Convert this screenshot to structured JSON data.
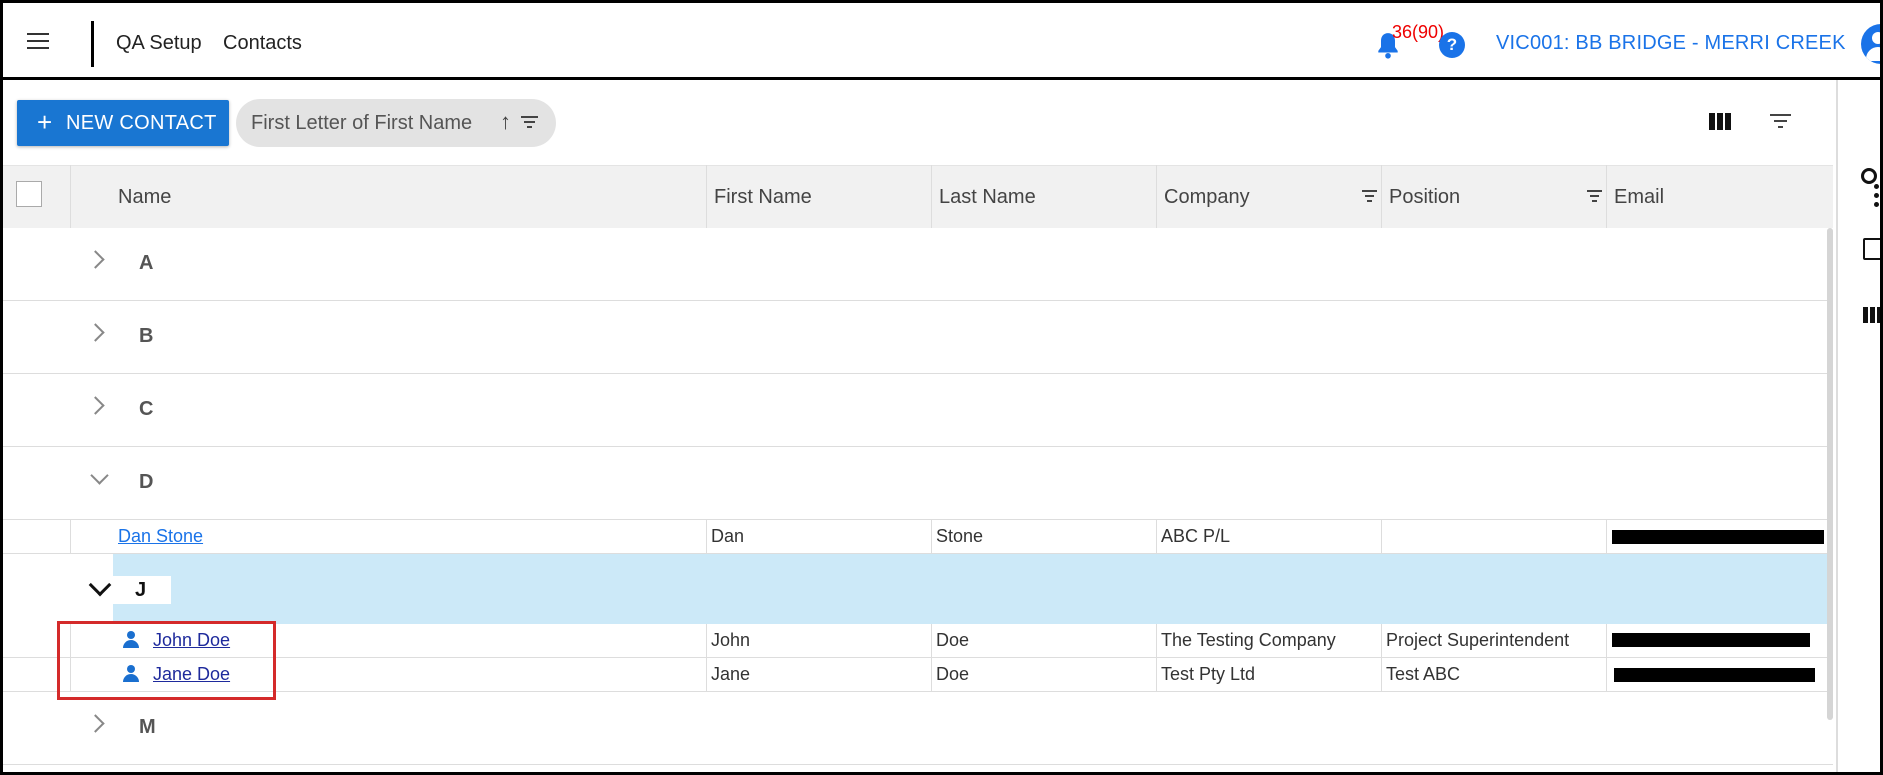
{
  "header": {
    "app_title": "QA Setup",
    "page_title": "Contacts",
    "notification_count": "36(90)",
    "help_label": "?",
    "site_name": "VIC001: BB BRIDGE - MERRI CREEK"
  },
  "toolbar": {
    "new_contact_label": "NEW CONTACT",
    "new_contact_plus": "+",
    "group_by_label": "First Letter of First Name",
    "group_sort_arrow": "↑"
  },
  "grid": {
    "columns": [
      "Name",
      "First Name",
      "Last Name",
      "Company",
      "Position",
      "Email"
    ],
    "groups": {
      "A": "A",
      "B": "B",
      "C": "C",
      "D": "D",
      "J": "J",
      "M": "M"
    },
    "rows": [
      {
        "name": "Dan Stone",
        "first_name": "Dan",
        "last_name": "Stone",
        "company": "ABC P/L",
        "position": ""
      },
      {
        "name": "John Doe",
        "first_name": "John",
        "last_name": "Doe",
        "company": "The Testing Company",
        "position": "Project Superintendent"
      },
      {
        "name": "Jane Doe",
        "first_name": "Jane",
        "last_name": "Doe",
        "company": "Test Pty Ltd",
        "position": "Test ABC"
      }
    ]
  },
  "icons": {
    "menu": "hamburger-icon",
    "notifications": "bell-icon",
    "help": "help-icon",
    "account": "avatar-icon",
    "group_filter": "filter-icon",
    "columns": "columns-icon",
    "filter": "filter-icon",
    "more": "more-vertical-icon",
    "search": "search-icon",
    "list": "list-icon",
    "contact": "person-icon"
  },
  "colors": {
    "accent": "#1976d2",
    "selected_group": "#cce9f8",
    "highlight_box": "#d42a2a",
    "badge": "#e00000"
  }
}
